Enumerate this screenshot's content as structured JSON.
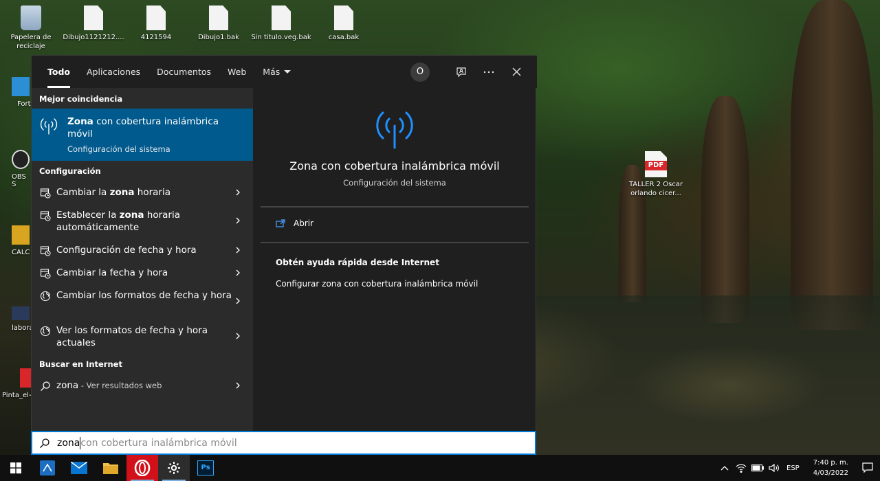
{
  "desktop": {
    "icons": [
      {
        "label": "Papelera de reciclaje",
        "icon": "recycle-bin-icon"
      },
      {
        "label": "Dibujo1121212....",
        "icon": "file-icon"
      },
      {
        "label": "4121594",
        "icon": "file-icon"
      },
      {
        "label": "Dibujo1.bak",
        "icon": "file-icon"
      },
      {
        "label": "Sin titulo.veg.bak",
        "icon": "file-icon"
      },
      {
        "label": "casa.bak",
        "icon": "file-icon"
      },
      {
        "label": "TALLER 2 Oscar orlando cicer...",
        "icon": "pdf-icon",
        "badge": "PDF"
      }
    ],
    "side_icons": [
      {
        "label": "Fort"
      },
      {
        "label": "OBS S"
      },
      {
        "label": "CALC"
      },
      {
        "label": "labora"
      },
      {
        "label": "Pinta_el-"
      }
    ]
  },
  "search_panel": {
    "tabs": [
      "Todo",
      "Aplicaciones",
      "Documentos",
      "Web",
      "Más"
    ],
    "active_tab": "Todo",
    "avatar_letter": "O",
    "sections": {
      "best_match": "Mejor coincidencia",
      "settings": "Configuración",
      "web": "Buscar en Internet"
    },
    "best_match": {
      "bold": "Zona",
      "rest": " con cobertura inalámbrica móvil",
      "subtitle": "Configuración del sistema",
      "icon": "mobile-hotspot-icon"
    },
    "settings_results": [
      {
        "pre": "Cambiar la ",
        "bold": "zona",
        "post": " horaria",
        "icon": "calendar-clock-icon"
      },
      {
        "pre": "Establecer la ",
        "bold": "zona",
        "post": " horaria automáticamente",
        "icon": "calendar-clock-icon"
      },
      {
        "pre": "Configuración de fecha y hora",
        "bold": "",
        "post": "",
        "icon": "calendar-clock-icon"
      },
      {
        "pre": "Cambiar la fecha y hora",
        "bold": "",
        "post": "",
        "icon": "calendar-clock-icon"
      },
      {
        "pre": "Cambiar los formatos de fecha y hora",
        "bold": "",
        "post": "",
        "icon": "region-icon"
      },
      {
        "pre": "Ver los formatos de fecha y hora actuales",
        "bold": "",
        "post": "",
        "icon": "region-icon"
      }
    ],
    "web_result": {
      "query": "zona",
      "suffix": " - Ver resultados web",
      "icon": "search-icon"
    },
    "preview": {
      "title": "Zona con cobertura inalámbrica móvil",
      "subtitle": "Configuración del sistema",
      "open_label": "Abrir",
      "help_heading": "Obtén ayuda rápida desde Internet",
      "help_link": "Configurar zona con cobertura inalámbrica móvil"
    }
  },
  "searchbox": {
    "typed": "zona",
    "suggestion": "con cobertura inalámbrica móvil"
  },
  "taskbar": {
    "apps": [
      "start-icon",
      "backup-app-icon",
      "mail-icon",
      "file-explorer-icon",
      "opera-icon",
      "settings-icon",
      "photoshop-icon"
    ],
    "photoshop_label": "Ps",
    "language": "ESP",
    "time": "7:40 p. m.",
    "date": "4/03/2022"
  },
  "colors": {
    "accent": "#0078d7",
    "best_match_bg": "#005a8d",
    "hotspot_blue": "#1e90ff",
    "panel_bg": "#1f1f1f",
    "list_bg": "#2b2b2b"
  }
}
